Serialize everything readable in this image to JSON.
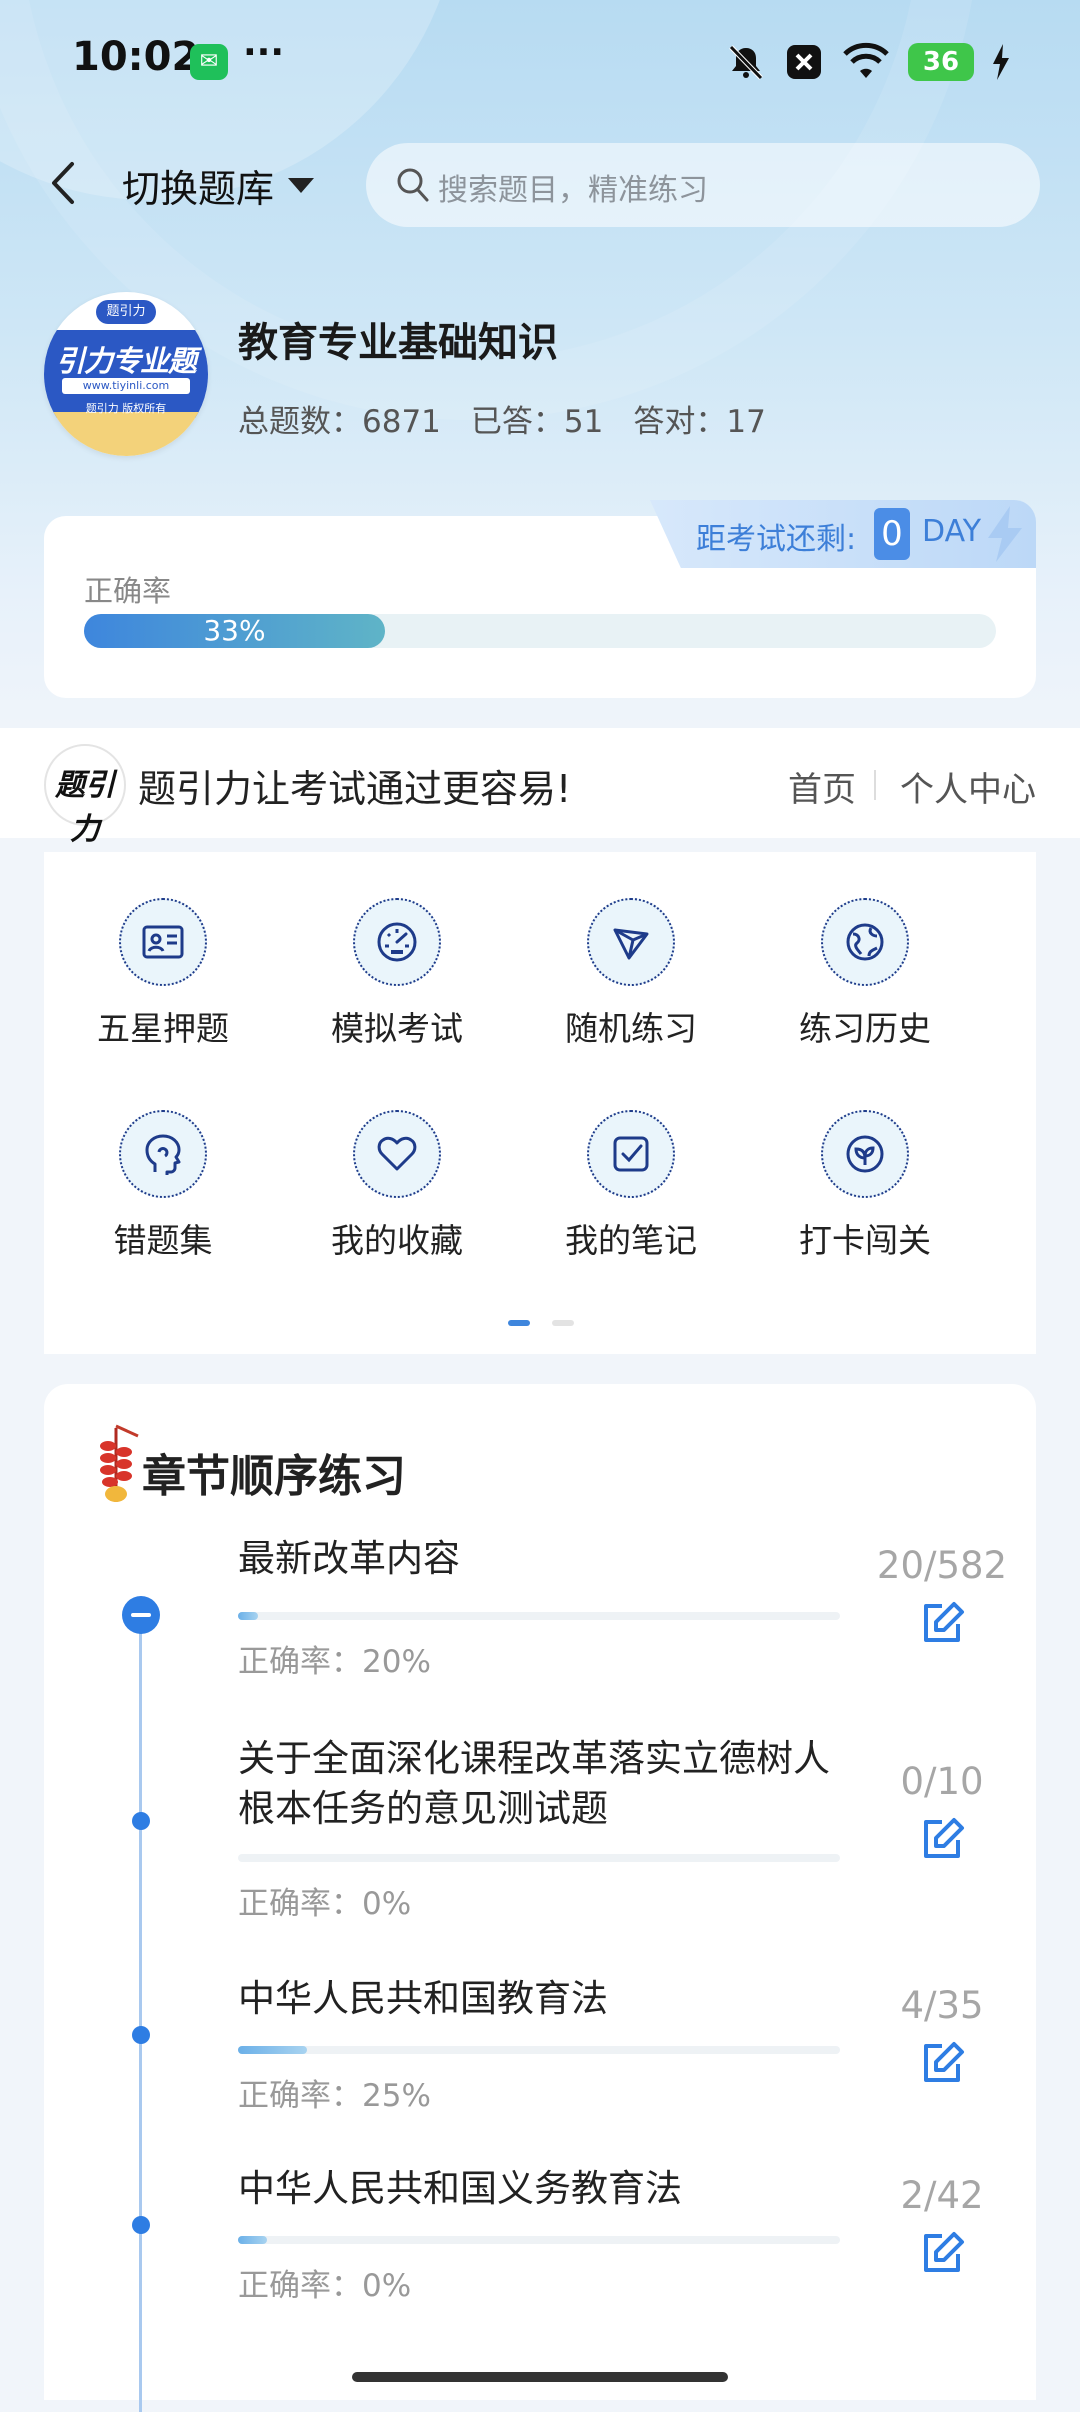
{
  "status_bar": {
    "time": "10:02",
    "more": "···",
    "battery": "36"
  },
  "header": {
    "switch_label": "切换题库",
    "search_placeholder": "搜索题目，精准练习"
  },
  "bank": {
    "logo_top": "题引力",
    "logo_text": "引力专业题",
    "logo_url": "www.tiyinli.com",
    "logo_footer": "题引力 版权所有",
    "title": "教育专业基础知识",
    "total_label": "总题数：6871",
    "answered_label": "已答：51",
    "correct_label": "答对：17"
  },
  "accuracy": {
    "label": "正确率",
    "value_text": "33%",
    "value": 0.33,
    "countdown_label": "距考试还剩:",
    "countdown_days": "0",
    "countdown_unit": "DAY"
  },
  "promo": {
    "logo_text": "题引力",
    "slogan": "题引力让考试通过更容易!",
    "home": "首页",
    "me": "个人中心"
  },
  "features": [
    {
      "label": "五星押题",
      "icon": "id-card-icon"
    },
    {
      "label": "模拟考试",
      "icon": "speedometer-icon"
    },
    {
      "label": "随机练习",
      "icon": "network-icon"
    },
    {
      "label": "练习历史",
      "icon": "globe-icon"
    },
    {
      "label": "错题集",
      "icon": "head-icon"
    },
    {
      "label": "我的收藏",
      "icon": "heart-icon"
    },
    {
      "label": "我的笔记",
      "icon": "note-icon"
    },
    {
      "label": "打卡闯关",
      "icon": "leaf-icon"
    }
  ],
  "chapters_title": "章节顺序练习",
  "chapters": [
    {
      "name": "最新改革内容",
      "rate": "正确率：20%",
      "count": "20/582",
      "progress": 0.034
    },
    {
      "name": "关于全面深化课程改革落实立德树人根本任务的意见测试题",
      "rate": "正确率：0%",
      "count": "0/10",
      "progress": 0
    },
    {
      "name": "中华人民共和国教育法",
      "rate": "正确率：25%",
      "count": "4/35",
      "progress": 0.114
    },
    {
      "name": "中华人民共和国义务教育法",
      "rate": "正确率：0%",
      "count": "2/42",
      "progress": 0.048
    }
  ],
  "colors": {
    "accent": "#2e7de3",
    "progress_start": "#3e86dd",
    "progress_end": "#5fb4c7"
  }
}
